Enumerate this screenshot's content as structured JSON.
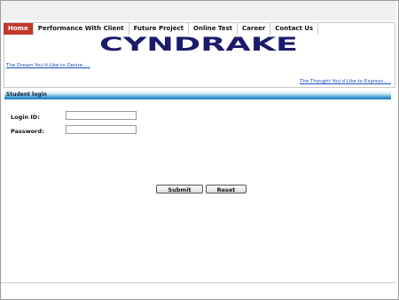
{
  "nav": {
    "items": [
      {
        "label": "Home",
        "active": true
      },
      {
        "label": "Performance With Client",
        "active": false
      },
      {
        "label": "Future Project",
        "active": false
      },
      {
        "label": "Online Test",
        "active": false
      },
      {
        "label": "Career",
        "active": false
      },
      {
        "label": "Contact Us",
        "active": false
      }
    ]
  },
  "header": {
    "logo_text": "CYNDRAKE",
    "logo_color": "#1b1a6b",
    "tagline_left": "The Dream You'd Like to Desire.....",
    "tagline_right": "The Thought You'd Like to Express....."
  },
  "section": {
    "title": "Student login"
  },
  "form": {
    "login_label": "Login ID:",
    "login_value": "",
    "password_label": "Password:",
    "password_value": "",
    "submit_label": "Submit",
    "reset_label": "Reset"
  },
  "colors": {
    "nav_active": "#c0392b",
    "section_bar": "#1f84c7",
    "link": "#1a4ec4"
  }
}
